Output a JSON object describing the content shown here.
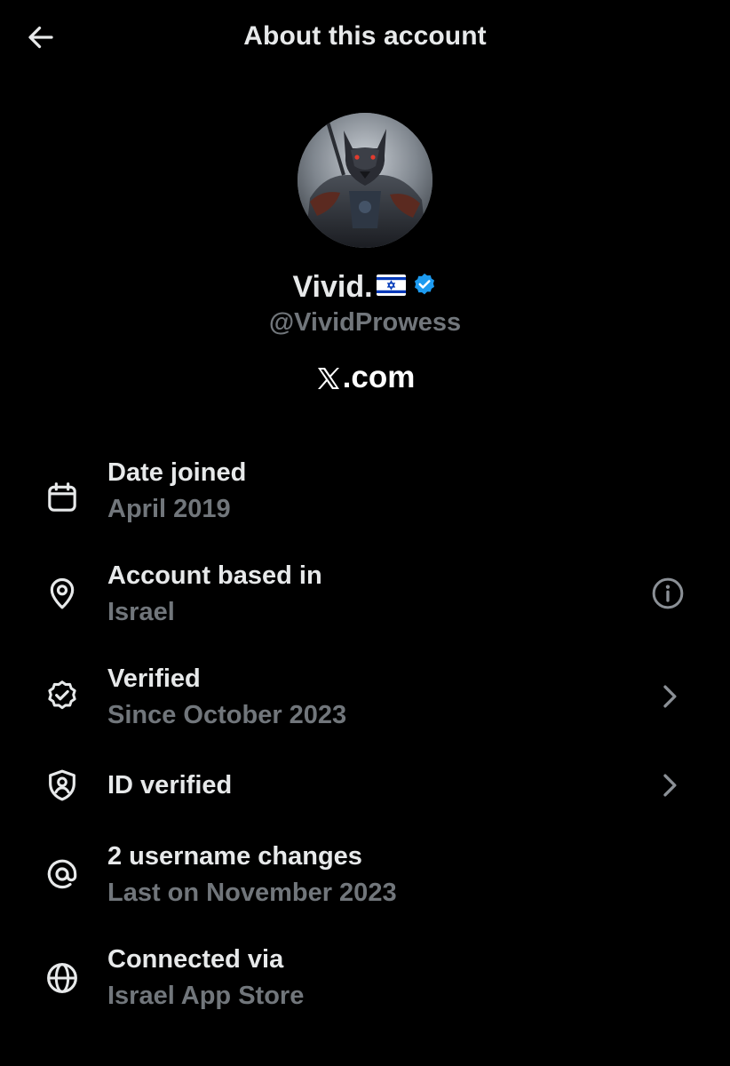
{
  "header": {
    "title": "About this account",
    "back_icon": "arrow-left-icon"
  },
  "profile": {
    "display_name": "Vivid.",
    "flag_icon": "israel-flag-icon",
    "verified_icon": "verified-badge-icon",
    "handle": "@VividProwess",
    "site_label": ".com",
    "site_logo_icon": "x-logo-icon"
  },
  "details": [
    {
      "icon": "calendar-icon",
      "title": "Date joined",
      "subtitle": "April 2019"
    },
    {
      "icon": "location-pin-icon",
      "title": "Account based in",
      "subtitle": "Israel",
      "action_icon": "info-icon"
    },
    {
      "icon": "verified-check-icon",
      "title": "Verified",
      "subtitle": "Since October 2023",
      "action_icon": "chevron-right-icon"
    },
    {
      "icon": "id-shield-icon",
      "title": "ID verified",
      "action_icon": "chevron-right-icon"
    },
    {
      "icon": "at-sign-icon",
      "title": "2 username changes",
      "subtitle": "Last on November 2023"
    },
    {
      "icon": "globe-icon",
      "title": "Connected via",
      "subtitle": "Israel App Store"
    }
  ],
  "colors": {
    "background": "#000000",
    "primary_text": "#e7e9ea",
    "secondary_text": "#71767b",
    "verified_blue": "#1d9bf0",
    "flag_blue": "#0038b8"
  }
}
